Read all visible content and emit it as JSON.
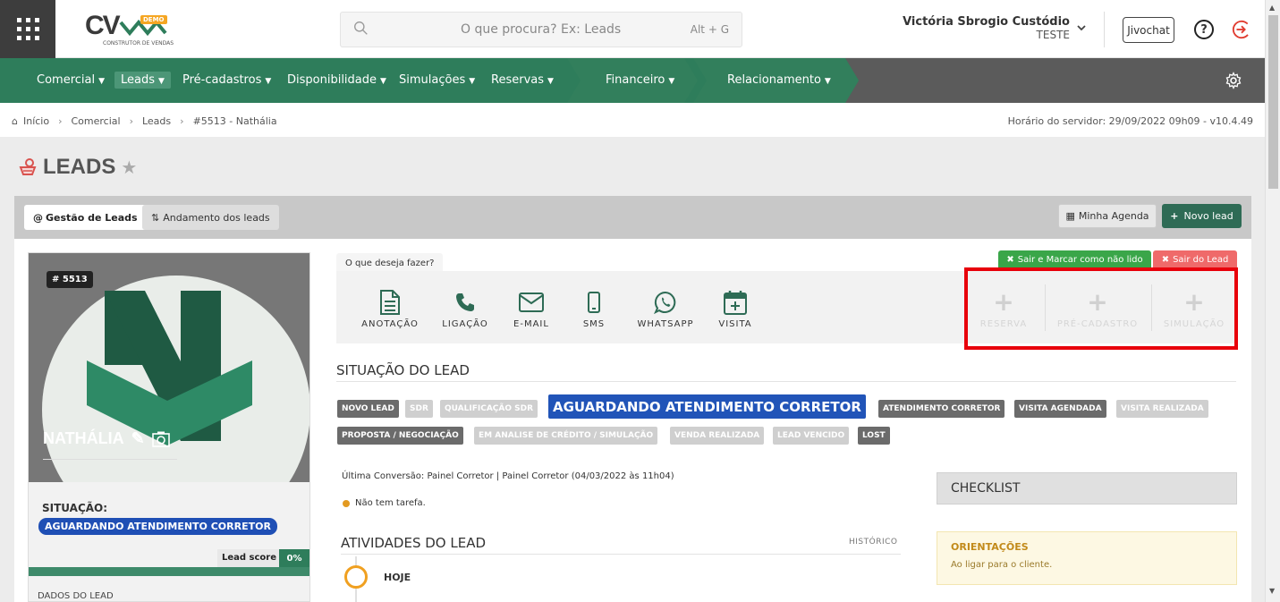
{
  "header": {
    "logo_text": "CV",
    "logo_badge": "DEMO",
    "logo_subtitle": "CONSTRUTOR DE VENDAS",
    "search_placeholder": "O que procura? Ex: Leads",
    "search_shortcut": "Alt + G",
    "user_name": "Victória Sbrogio Custódio",
    "user_role": "TESTE",
    "jivochat_label": "Jivochat",
    "help_label": "?"
  },
  "nav": {
    "items": [
      {
        "label": "Comercial"
      },
      {
        "label": "Leads"
      },
      {
        "label": "Pré-cadastros"
      },
      {
        "label": "Disponibilidade"
      },
      {
        "label": "Simulações"
      },
      {
        "label": "Reservas"
      },
      {
        "label": "Financeiro"
      },
      {
        "label": "Relacionamento"
      }
    ],
    "active": "Leads"
  },
  "breadcrumb": {
    "items": [
      "Início",
      "Comercial",
      "Leads",
      "#5513 - Nathália"
    ],
    "server_time": "Horário do servidor: 29/09/2022 09h09 - v10.4.49"
  },
  "page": {
    "title": "LEADS"
  },
  "tabs": {
    "gestao": "Gestão de Leads",
    "andamento": "Andamento dos leads",
    "agenda": "Minha Agenda",
    "novo_lead": "Novo lead"
  },
  "profile": {
    "id": "# 5513",
    "name": "NATHÁLIA",
    "situacao_label": "SITUAÇÃO:",
    "situacao_value": "AGUARDANDO ATENDIMENTO CORRETOR",
    "score_label": "Lead score",
    "score_value": "0%",
    "dados_label": "DADOS DO LEAD"
  },
  "actions": {
    "prompt": "O que deseja fazer?",
    "items": [
      {
        "label": "ANOTAÇÃO",
        "icon": "document-icon"
      },
      {
        "label": "LIGAÇÃO",
        "icon": "phone-icon"
      },
      {
        "label": "E-MAIL",
        "icon": "envelope-icon"
      },
      {
        "label": "SMS",
        "icon": "mobile-icon"
      },
      {
        "label": "WHATSAPP",
        "icon": "whatsapp-icon"
      },
      {
        "label": "VISITA",
        "icon": "calendar-plus-icon"
      }
    ],
    "disabled": [
      {
        "label": "RESERVA"
      },
      {
        "label": "PRÉ-CADASTRO"
      },
      {
        "label": "SIMULAÇÃO"
      }
    ],
    "marcar_label": "Sair e Marcar como não lido",
    "sair_label": "Sair do Lead"
  },
  "situacao": {
    "title": "SITUAÇÃO DO LEAD",
    "statuses": [
      {
        "label": "NOVO LEAD",
        "style": "dark"
      },
      {
        "label": "SDR",
        "style": "light"
      },
      {
        "label": "QUALIFICAÇÃO SDR",
        "style": "light"
      },
      {
        "label": "AGUARDANDO ATENDIMENTO CORRETOR",
        "style": "current"
      },
      {
        "label": "ATENDIMENTO CORRETOR",
        "style": "dark"
      },
      {
        "label": "VISITA AGENDADA",
        "style": "dark"
      },
      {
        "label": "VISITA REALIZADA",
        "style": "light"
      },
      {
        "label": "PROPOSTA / NEGOCIAÇÃO",
        "style": "dark"
      },
      {
        "label": "EM ANALISE DE CRÉDITO / SIMULAÇÃO",
        "style": "light"
      },
      {
        "label": "VENDA REALIZADA",
        "style": "light"
      },
      {
        "label": "LEAD VENCIDO",
        "style": "light"
      },
      {
        "label": "LOST",
        "style": "dark"
      }
    ]
  },
  "info": {
    "ultima_conversao": "Última Conversão: Painel Corretor | Painel Corretor (04/03/2022 às 11h04)",
    "tarefa": "Não tem tarefa."
  },
  "atividades": {
    "title": "ATIVIDADES DO LEAD",
    "historico": "HISTÓRICO",
    "hoje": "HOJE"
  },
  "checklist": {
    "title": "CHECKLIST"
  },
  "orientacoes": {
    "title": "ORIENTAÇÕES",
    "body": "Ao ligar para o cliente."
  },
  "colors": {
    "brand_green": "#2e7d5b",
    "current_status": "#2154b8",
    "highlight": "#e8000b"
  }
}
